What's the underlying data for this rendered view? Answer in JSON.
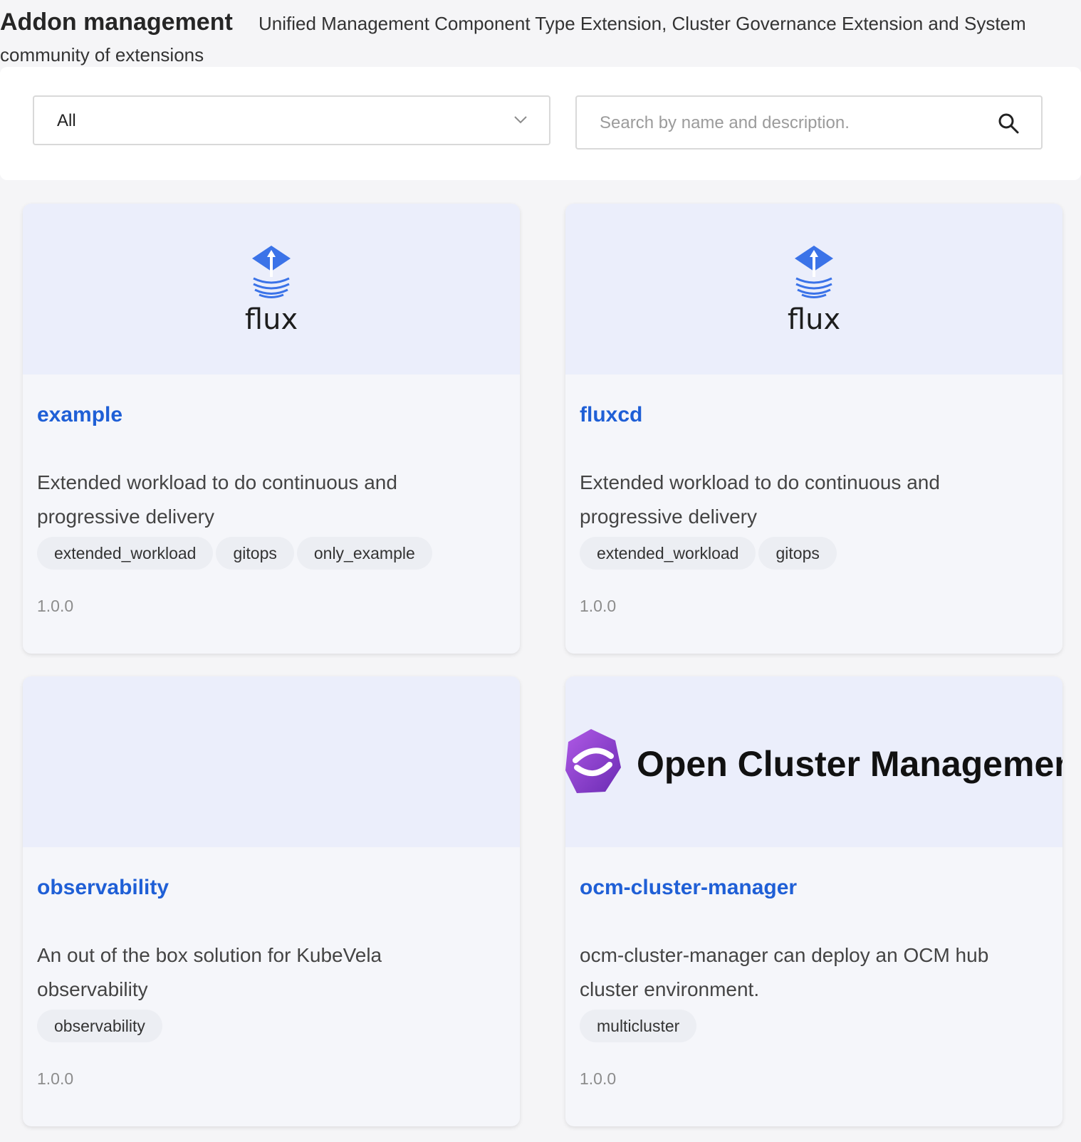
{
  "header": {
    "title": "Addon management",
    "description_line1": "Unified Management Component Type Extension, Cluster Governance Extension and System",
    "description_line2": "community of extensions"
  },
  "filter": {
    "registry_selected": "All",
    "search_placeholder": "Search by name and description."
  },
  "addons": [
    {
      "name": "example",
      "description": "Extended workload to do continuous and progressive delivery",
      "tags": [
        "extended_workload",
        "gitops",
        "only_example"
      ],
      "version": "1.0.0",
      "logo_text": "flux"
    },
    {
      "name": "fluxcd",
      "description": "Extended workload to do continuous and progressive delivery",
      "tags": [
        "extended_workload",
        "gitops"
      ],
      "version": "1.0.0",
      "logo_text": "flux"
    },
    {
      "name": "observability",
      "description": "An out of the box solution for KubeVela observability",
      "tags": [
        "observability"
      ],
      "version": "1.0.0",
      "logo_text": ""
    },
    {
      "name": "ocm-cluster-manager",
      "description": "ocm-cluster-manager can deploy an OCM hub cluster environment.",
      "tags": [
        "multicluster"
      ],
      "version": "1.0.0",
      "logo_text": "Open Cluster Management"
    }
  ],
  "colors": {
    "link": "#1f5fd6",
    "flux_blue": "#3b73e8",
    "ocm_purple": "#8a3fd1"
  }
}
